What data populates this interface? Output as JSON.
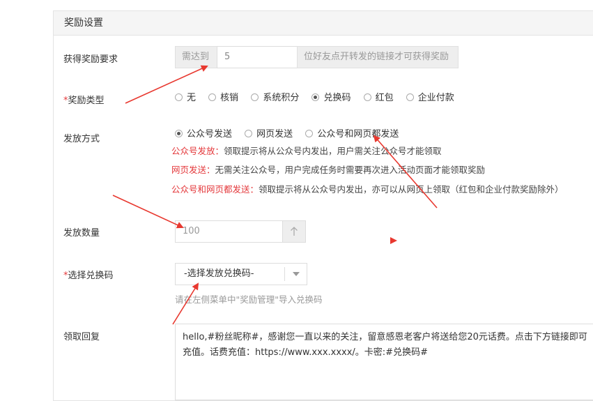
{
  "panel": {
    "title": "奖励设置"
  },
  "requirement": {
    "label": "获得奖励要求",
    "prefix": "需达到",
    "value": "5",
    "suffix": "位好友点开转发的链接才可获得奖励"
  },
  "reward_type": {
    "required_mark": "*",
    "label": "奖励类型",
    "options": [
      "无",
      "核销",
      "系统积分",
      "兑换码",
      "红包",
      "企业付款"
    ],
    "selected": "兑换码"
  },
  "delivery": {
    "label": "发放方式",
    "options": [
      "公众号发送",
      "网页发送",
      "公众号和网页都发送"
    ],
    "selected": "公众号发送",
    "notes": [
      {
        "title": "公众号发放：",
        "text": "领取提示将从公众号内发出，用户需关注公众号才能领取"
      },
      {
        "title": "网页发送：",
        "text": "无需关注公众号，用户完成任务时需要再次进入活动页面才能领取奖励"
      },
      {
        "title": "公众号和网页都发送：",
        "text": "领取提示将从公众号内发出，亦可以从网页上领取（红包和企业付款奖励除外）"
      }
    ]
  },
  "quantity": {
    "label": "发放数量",
    "value": "100",
    "step_icon": "arrow-up-icon"
  },
  "code_select": {
    "required_mark": "*",
    "label": "选择兑换码",
    "value": "-选择发放兑换码-",
    "hint": "请在左侧菜单中\"奖励管理\"导入兑换码"
  },
  "reply": {
    "label": "领取回复",
    "value": "hello,#粉丝昵称#，感谢您一直以来的关注，留意感恩老客户将送给您20元话费。点击下方链接即可充值。话费充值：https://www.xxx.xxxx/。卡密:#兑换码#"
  },
  "colors": {
    "accent_red": "#e4393c",
    "arrow_red": "#e8382f"
  }
}
